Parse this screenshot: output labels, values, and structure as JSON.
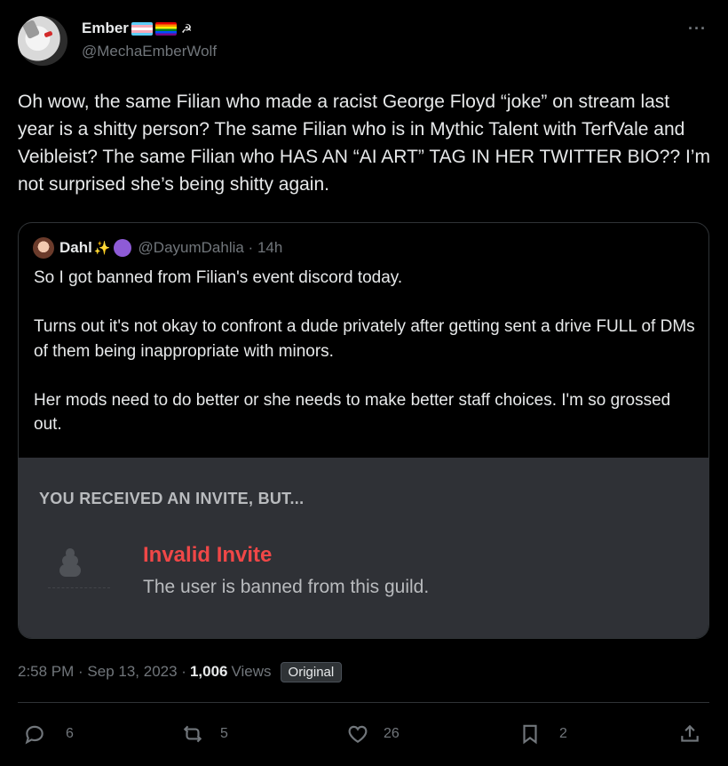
{
  "author": {
    "display_name": "Ember",
    "handle": "@MechaEmberWolf"
  },
  "tweet": {
    "text": "Oh wow, the same Filian who made a racist George Floyd “joke” on stream last year is a shitty person? The same Filian who is in Mythic Talent with TerfVale and Veibleist? The same Filian who HAS AN “AI ART” TAG IN HER TWITTER BIO?? I’m not surprised she’s being shitty again."
  },
  "quote": {
    "display_name": "Dahl",
    "handle_time": "@DayumDahlia · 14h",
    "text": "So I got banned from Filian's event discord today.\n\nTurns out it's not okay to confront a dude privately after getting sent a drive FULL of DMs of them being inappropriate with minors.\n\nHer mods need to do better or she needs to make better staff choices. I'm so grossed out.",
    "invite": {
      "header": "YOU RECEIVED AN INVITE, BUT...",
      "title": "Invalid Invite",
      "subtitle": "The user is banned from this guild.",
      "title_color": "#f04747"
    }
  },
  "meta": {
    "timestamp": "2:58 PM · Sep 13, 2023 ·",
    "views_count": "1,006",
    "views_label": "Views",
    "badge": "Original"
  },
  "actions": {
    "replies": "6",
    "reposts": "5",
    "likes": "26",
    "bookmarks": "2"
  },
  "icons": [
    "more-icon",
    "reply-icon",
    "repost-icon",
    "like-icon",
    "bookmark-icon",
    "share-icon"
  ]
}
